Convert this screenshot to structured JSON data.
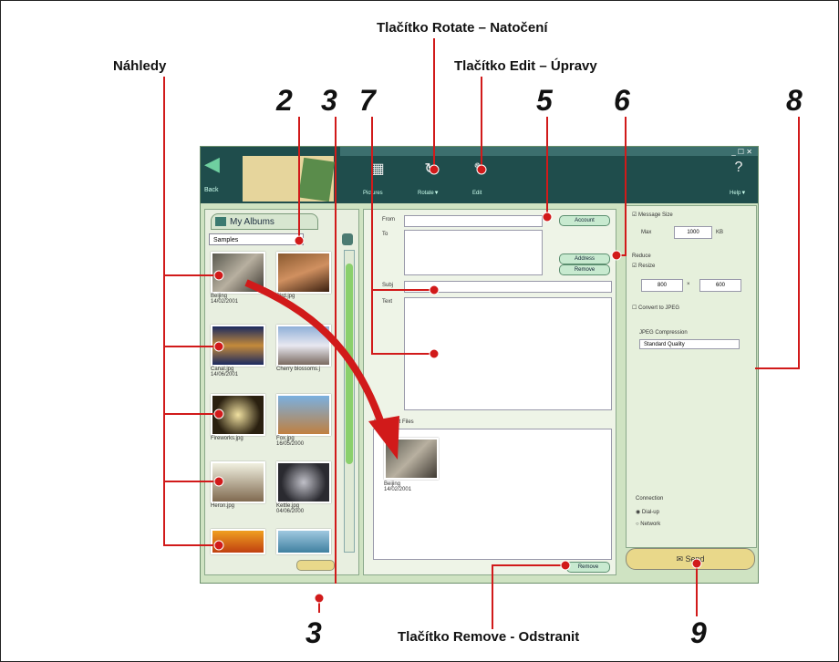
{
  "callouts": {
    "rotate": "Tlačítko Rotate – Natočení",
    "edit": "Tlačítko Edit – Úpravy",
    "previews": "Náhledy",
    "remove": "Tlačítko Remove - Odstranit"
  },
  "numbers": {
    "n2": "2",
    "n3a": "3",
    "n7": "7",
    "n5": "5",
    "n6": "6",
    "n8": "8",
    "n3b": "3",
    "n9": "9"
  },
  "app": {
    "back_label": "Back",
    "toolbar": {
      "pictures": "Pictures",
      "rotate": "Rotate▼",
      "edit": "Edit",
      "help": "Help▼"
    },
    "albums_tab": "My Albums",
    "album_combo": "Samples",
    "thumbnails": [
      {
        "caption": "Beijing\n14/02/2001"
      },
      {
        "caption": "Bird.jpg"
      },
      {
        "caption": "Canal.jpg\n14/06/2001"
      },
      {
        "caption": "Cherry blossoms.j"
      },
      {
        "caption": "Fireworks.jpg"
      },
      {
        "caption": "Fox.jpg\n16/05/2000"
      },
      {
        "caption": "Heron.jpg"
      },
      {
        "caption": "Kettle.jpg\n04/06/2000"
      }
    ],
    "mail": {
      "from_label": "From",
      "to_label": "To",
      "subject_label": "Subj",
      "text_label": "Text",
      "account_btn": "Account",
      "address_btn": "Address",
      "remove_addr_btn": "Remove",
      "attached_label": "Attachment Files",
      "attached_caption": "Beijing\n14/02/2001",
      "remove_btn": "Remove"
    },
    "options": {
      "message_size": "Message Size",
      "max_label": "Max",
      "max_value": "1000",
      "max_unit": "KB",
      "reduce_label": "Reduce",
      "resize_label": "Resize",
      "w_value": "800",
      "h_value": "600",
      "convert_jpeg": "Convert to JPEG",
      "jpeg_compression": "JPEG Compression",
      "quality_value": "Standard Quality",
      "connection": "Connection",
      "dialup": "Dial-up",
      "network": "Network"
    },
    "send_btn": "Send"
  }
}
